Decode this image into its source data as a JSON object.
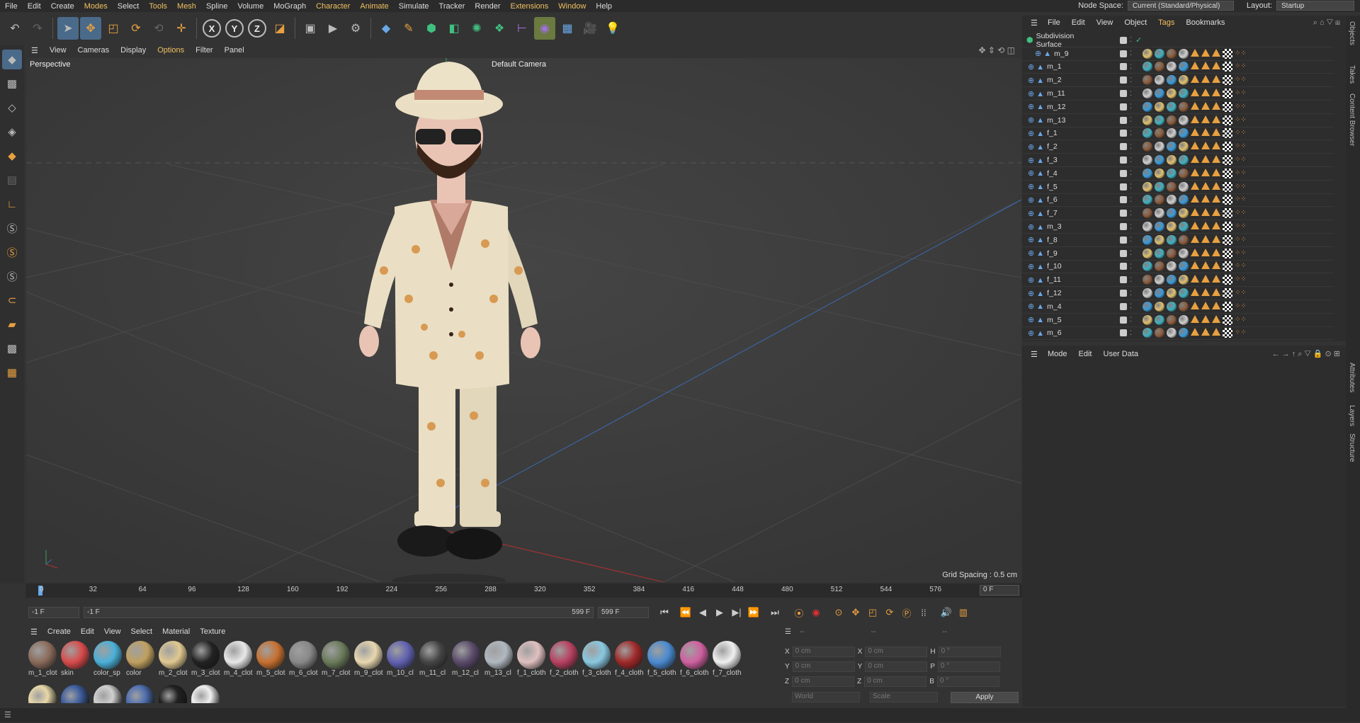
{
  "menu": [
    "File",
    "Edit",
    "Create",
    "Modes",
    "Select",
    "Tools",
    "Mesh",
    "Spline",
    "Volume",
    "MoGraph",
    "Character",
    "Animate",
    "Simulate",
    "Tracker",
    "Render",
    "Extensions",
    "Window",
    "Help"
  ],
  "node_space_label": "Node Space:",
  "node_space_value": "Current (Standard/Physical)",
  "layout_label": "Layout:",
  "layout_value": "Startup",
  "viewport_menu": [
    "View",
    "Cameras",
    "Display",
    "Options",
    "Filter",
    "Panel"
  ],
  "viewport_label": "Perspective",
  "camera_label": "Default Camera",
  "grid_spacing": "Grid Spacing : 0.5 cm",
  "timeline_ticks": [
    "0",
    "32",
    "64",
    "96",
    "128",
    "160",
    "192",
    "224",
    "256",
    "288",
    "320",
    "352",
    "384",
    "416",
    "448",
    "480",
    "512",
    "544",
    "576"
  ],
  "timeline_frame": "0 F",
  "transport": {
    "start": "-1 F",
    "start2": "-1 F",
    "end": "599 F",
    "end2": "599 F"
  },
  "material_menu": [
    "Create",
    "Edit",
    "View",
    "Select",
    "Material",
    "Texture"
  ],
  "materials": [
    "m_1_clot",
    "skin",
    "color_sp",
    "color",
    "m_2_clot",
    "m_3_clot",
    "m_4_clot",
    "m_5_clot",
    "m_6_clot",
    "m_7_clot",
    "m_9_clot",
    "m_10_cl",
    "m_11_cl",
    "m_12_cl",
    "m_13_cl",
    "f_1_cloth",
    "f_2_cloth",
    "f_3_cloth",
    "f_4_cloth",
    "f_5_cloth",
    "f_6_cloth",
    "f_7_cloth"
  ],
  "material_colors": [
    "#8a6a5a",
    "#d84a4a",
    "#4ab0d8",
    "#c0a060",
    "#e0c890",
    "#222222",
    "#e8e8e8",
    "#c87030",
    "#888888",
    "#6a7a5a",
    "#e8d8b0",
    "#6060b0",
    "#444444",
    "#5a4a6a",
    "#b0b8c0",
    "#e0c0c0",
    "#b84060",
    "#88c8e0",
    "#a02828",
    "#4a8ad0",
    "#d060a0",
    "#f0f0f0"
  ],
  "materials_row2_colors": [
    "#e8d8a8",
    "#4060a0",
    "#d0d0d0",
    "#5070b0",
    "#222222",
    "#f0f0f0"
  ],
  "objects_menu": [
    "File",
    "Edit",
    "View",
    "Object",
    "Tags",
    "Bookmarks"
  ],
  "objects": [
    "Subdivision Surface",
    "m_9",
    "m_1",
    "m_2",
    "m_11",
    "m_12",
    "m_13",
    "f_1",
    "f_2",
    "f_3",
    "f_4",
    "f_5",
    "f_6",
    "f_7",
    "m_3",
    "f_8",
    "f_9",
    "f_10",
    "f_11",
    "f_12",
    "m_4",
    "m_5",
    "m_6"
  ],
  "attributes_menu": [
    "Mode",
    "Edit",
    "User Data"
  ],
  "coords": {
    "labels_left": [
      "X",
      "Y",
      "Z"
    ],
    "labels_mid": [
      "X",
      "Y",
      "Z"
    ],
    "labels_right": [
      "H",
      "P",
      "B"
    ],
    "val_pos": "0 cm",
    "val_rot": "0 °",
    "world": "World",
    "scale": "Scale",
    "apply": "Apply",
    "dashes": "--"
  },
  "side_tabs": [
    "Objects",
    "Takes",
    "Content Browser",
    "Attributes",
    "Layers",
    "Structure"
  ]
}
